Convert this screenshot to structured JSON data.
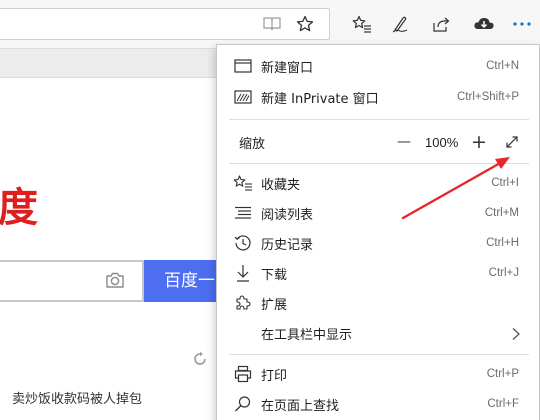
{
  "background_page": {
    "logo_fragment": "度",
    "search_button_label": "百度一下",
    "news_link": "卖炒饭收款码被人掉包"
  },
  "menu": {
    "new_window": {
      "label": "新建窗口",
      "shortcut": "Ctrl+N"
    },
    "new_inprivate": {
      "label": "新建 InPrivate 窗口",
      "shortcut": "Ctrl+Shift+P"
    },
    "zoom": {
      "label": "缩放",
      "minus": "—",
      "value": "100%",
      "plus": "+"
    },
    "favorites": {
      "label": "收藏夹",
      "shortcut": "Ctrl+I"
    },
    "reading_list": {
      "label": "阅读列表",
      "shortcut": "Ctrl+M"
    },
    "history": {
      "label": "历史记录",
      "shortcut": "Ctrl+H"
    },
    "downloads": {
      "label": "下载",
      "shortcut": "Ctrl+J"
    },
    "extensions": {
      "label": "扩展"
    },
    "show_in_toolbar": {
      "label": "在工具栏中显示"
    },
    "print": {
      "label": "打印",
      "shortcut": "Ctrl+P"
    },
    "find_on_page": {
      "label": "在页面上查找",
      "shortcut": "Ctrl+F"
    }
  },
  "colors": {
    "accent_blue": "#0078d7",
    "baidu_blue": "#4e6ef2",
    "baidu_red": "#de1f1f",
    "annotation_red": "#e8262a"
  },
  "icons": {
    "toolbar": [
      "reading-view-icon",
      "favorite-star-icon",
      "favorites-hub-icon",
      "pen-notes-icon",
      "share-icon",
      "cloud-download-icon",
      "more-dots-icon"
    ],
    "menu": [
      "window-icon",
      "inprivate-window-icon",
      "star-list-icon",
      "reading-list-icon",
      "history-clock-icon",
      "download-arrow-icon",
      "puzzle-extension-icon",
      "chevron-right-icon",
      "printer-icon",
      "magnifier-icon",
      "fullscreen-expand-icon"
    ]
  }
}
